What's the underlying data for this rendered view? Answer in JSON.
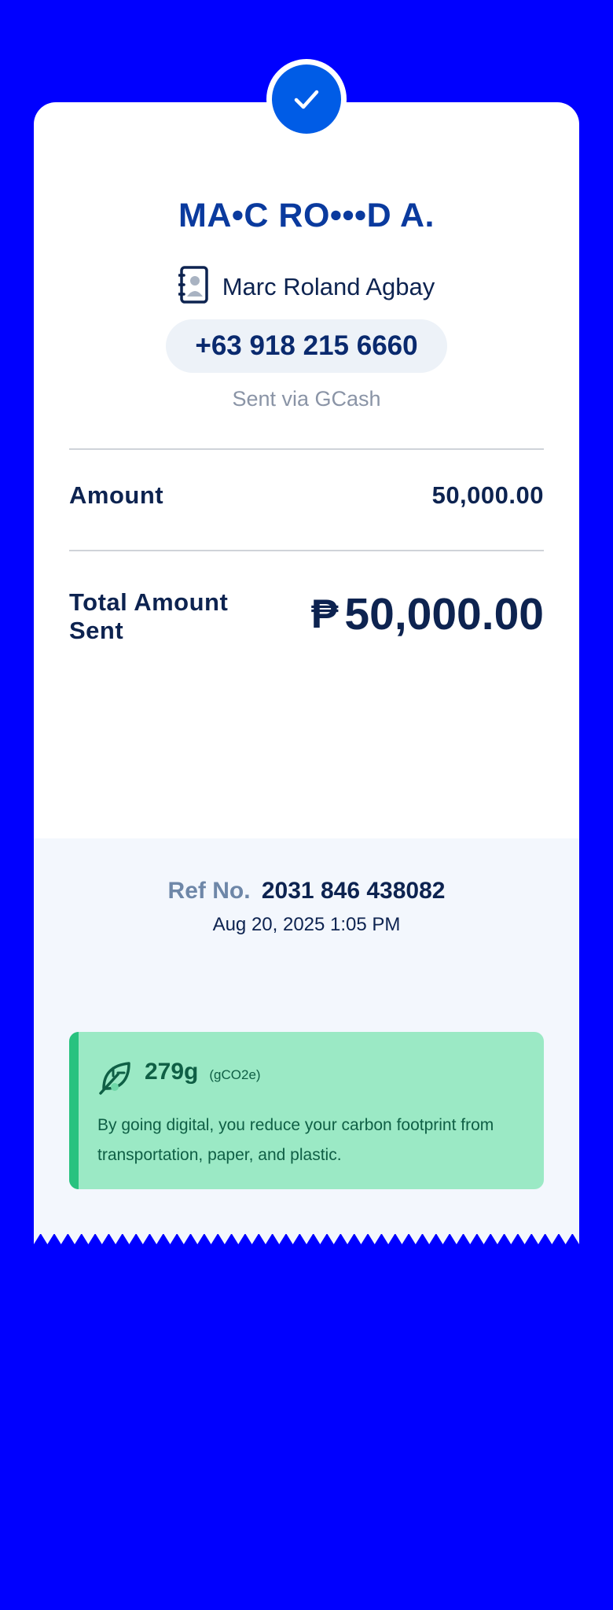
{
  "recipient": {
    "masked_name": "MA•C RO•••D A.",
    "contact_name": "Marc Roland Agbay",
    "phone": "+63 918 215 6660",
    "sent_via": "Sent via GCash"
  },
  "amount": {
    "label": "Amount",
    "value": "50,000.00"
  },
  "total": {
    "label": "Total Amount Sent",
    "currency_symbol": "₱",
    "value": "50,000.00"
  },
  "reference": {
    "label": "Ref No.",
    "number": "2031 846 438082",
    "datetime": "Aug 20, 2025 1:05 PM"
  },
  "eco": {
    "grams": "279g",
    "unit": "(gCO2e)",
    "message": "By going digital, you reduce your carbon footprint from transportation, paper, and plastic."
  },
  "colors": {
    "background": "#0000ff",
    "accent_blue": "#005ce6",
    "eco_green": "#9be9c5"
  }
}
